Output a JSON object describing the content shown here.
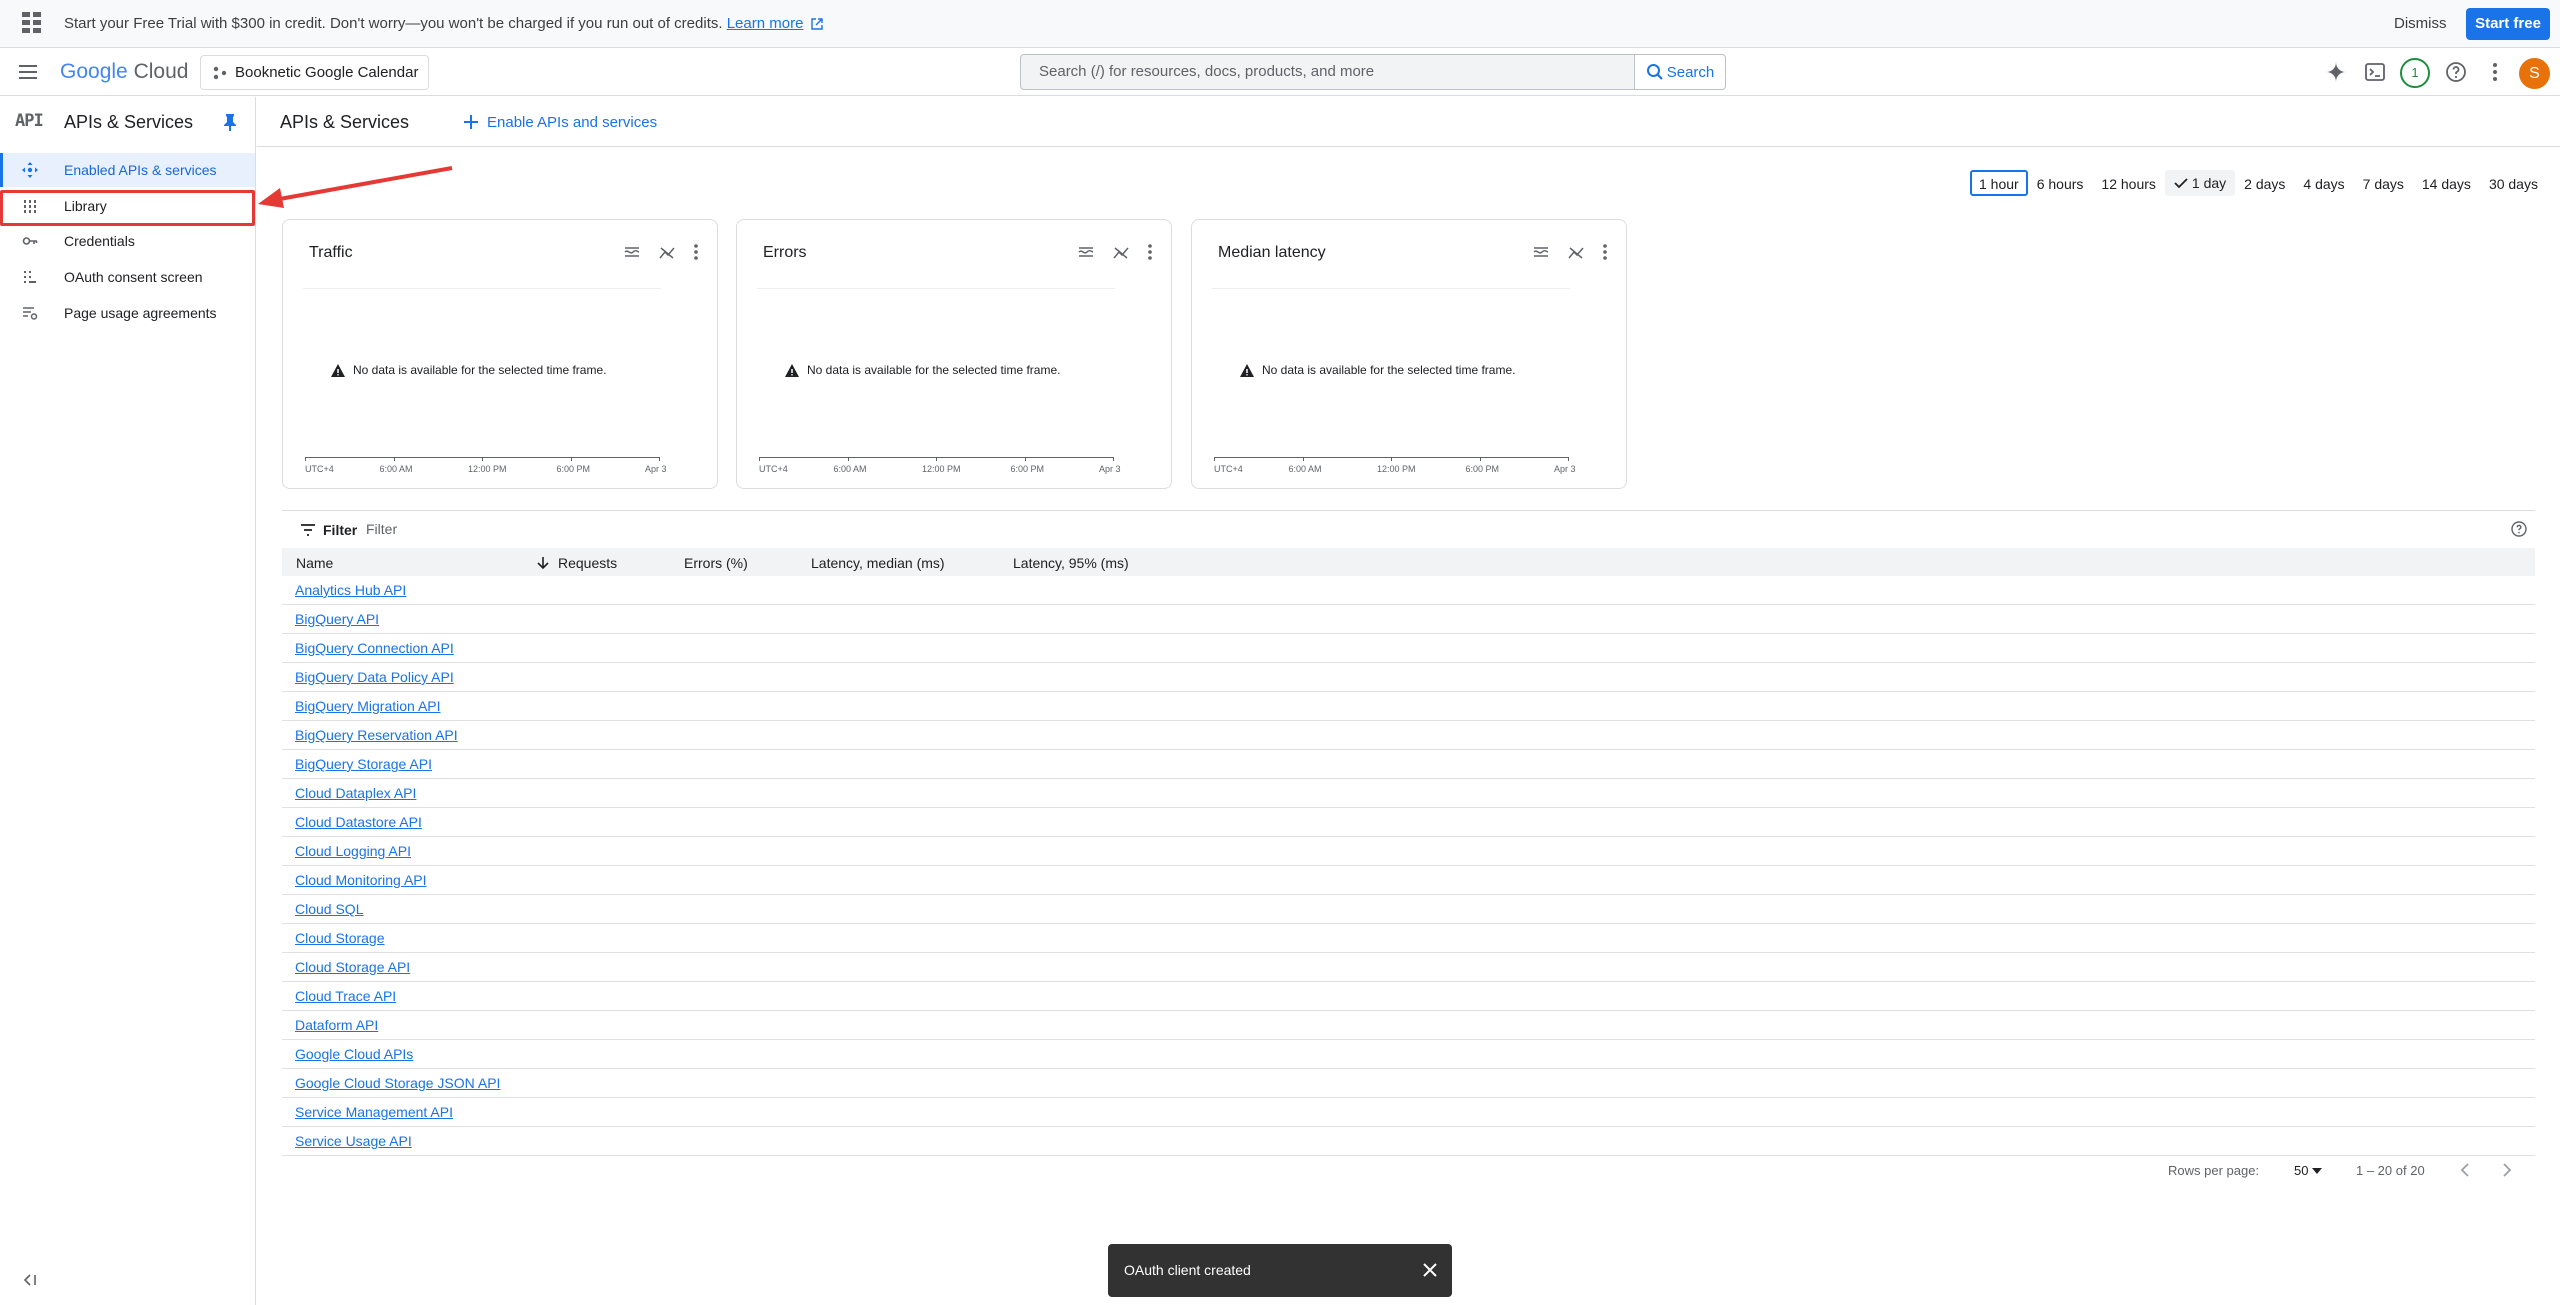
{
  "banner": {
    "message": "Start your Free Trial with $300 in credit. Don't worry—you won't be charged if you run out of credits.",
    "learn_more": "Learn more",
    "dismiss": "Dismiss",
    "start_free": "Start free"
  },
  "header": {
    "logo_google": "Google",
    "logo_cloud": "Cloud",
    "project": "Booknetic Google Calendar",
    "search_placeholder": "Search (/) for resources, docs, products, and more",
    "search_button": "Search",
    "notifications_count": "1",
    "avatar_initial": "S"
  },
  "sidebar": {
    "api_badge": "API",
    "title": "APIs & Services",
    "items": [
      {
        "label": "Enabled APIs & services"
      },
      {
        "label": "Library"
      },
      {
        "label": "Credentials"
      },
      {
        "label": "OAuth consent screen"
      },
      {
        "label": "Page usage agreements"
      }
    ]
  },
  "main": {
    "title": "APIs & Services",
    "enable_button": "Enable APIs and services",
    "time_ranges": [
      "1 hour",
      "6 hours",
      "12 hours",
      "1 day",
      "2 days",
      "4 days",
      "7 days",
      "14 days",
      "30 days"
    ],
    "selected_range": "1 hour",
    "checked_range": "1 day",
    "cards": [
      {
        "title": "Traffic",
        "nodata": "No data is available for the selected time frame.",
        "ticks": [
          "UTC+4",
          "6:00 AM",
          "12:00 PM",
          "6:00 PM",
          "Apr 3"
        ]
      },
      {
        "title": "Errors",
        "nodata": "No data is available for the selected time frame.",
        "ticks": [
          "UTC+4",
          "6:00 AM",
          "12:00 PM",
          "6:00 PM",
          "Apr 3"
        ]
      },
      {
        "title": "Median latency",
        "nodata": "No data is available for the selected time frame.",
        "ticks": [
          "UTC+4",
          "6:00 AM",
          "12:00 PM",
          "6:00 PM",
          "Apr 3"
        ]
      }
    ],
    "filter_label": "Filter",
    "filter_placeholder": "Filter",
    "columns": [
      "Name",
      "Requests",
      "Errors (%)",
      "Latency, median (ms)",
      "Latency, 95% (ms)"
    ],
    "rows": [
      "Analytics Hub API",
      "BigQuery API",
      "BigQuery Connection API",
      "BigQuery Data Policy API",
      "BigQuery Migration API",
      "BigQuery Reservation API",
      "BigQuery Storage API",
      "Cloud Dataplex API",
      "Cloud Datastore API",
      "Cloud Logging API",
      "Cloud Monitoring API",
      "Cloud SQL",
      "Cloud Storage",
      "Cloud Storage API",
      "Cloud Trace API",
      "Dataform API",
      "Google Cloud APIs",
      "Google Cloud Storage JSON API",
      "Service Management API",
      "Service Usage API"
    ],
    "pagination": {
      "rows_per_page_label": "Rows per page:",
      "rows_per_page": "50",
      "range": "1 – 20 of 20"
    }
  },
  "toast": {
    "message": "OAuth client created"
  },
  "colors": {
    "accent": "#1a73e8",
    "highlight": "#e53935",
    "toast_bg": "#323232",
    "avatar": "#e8710a"
  }
}
